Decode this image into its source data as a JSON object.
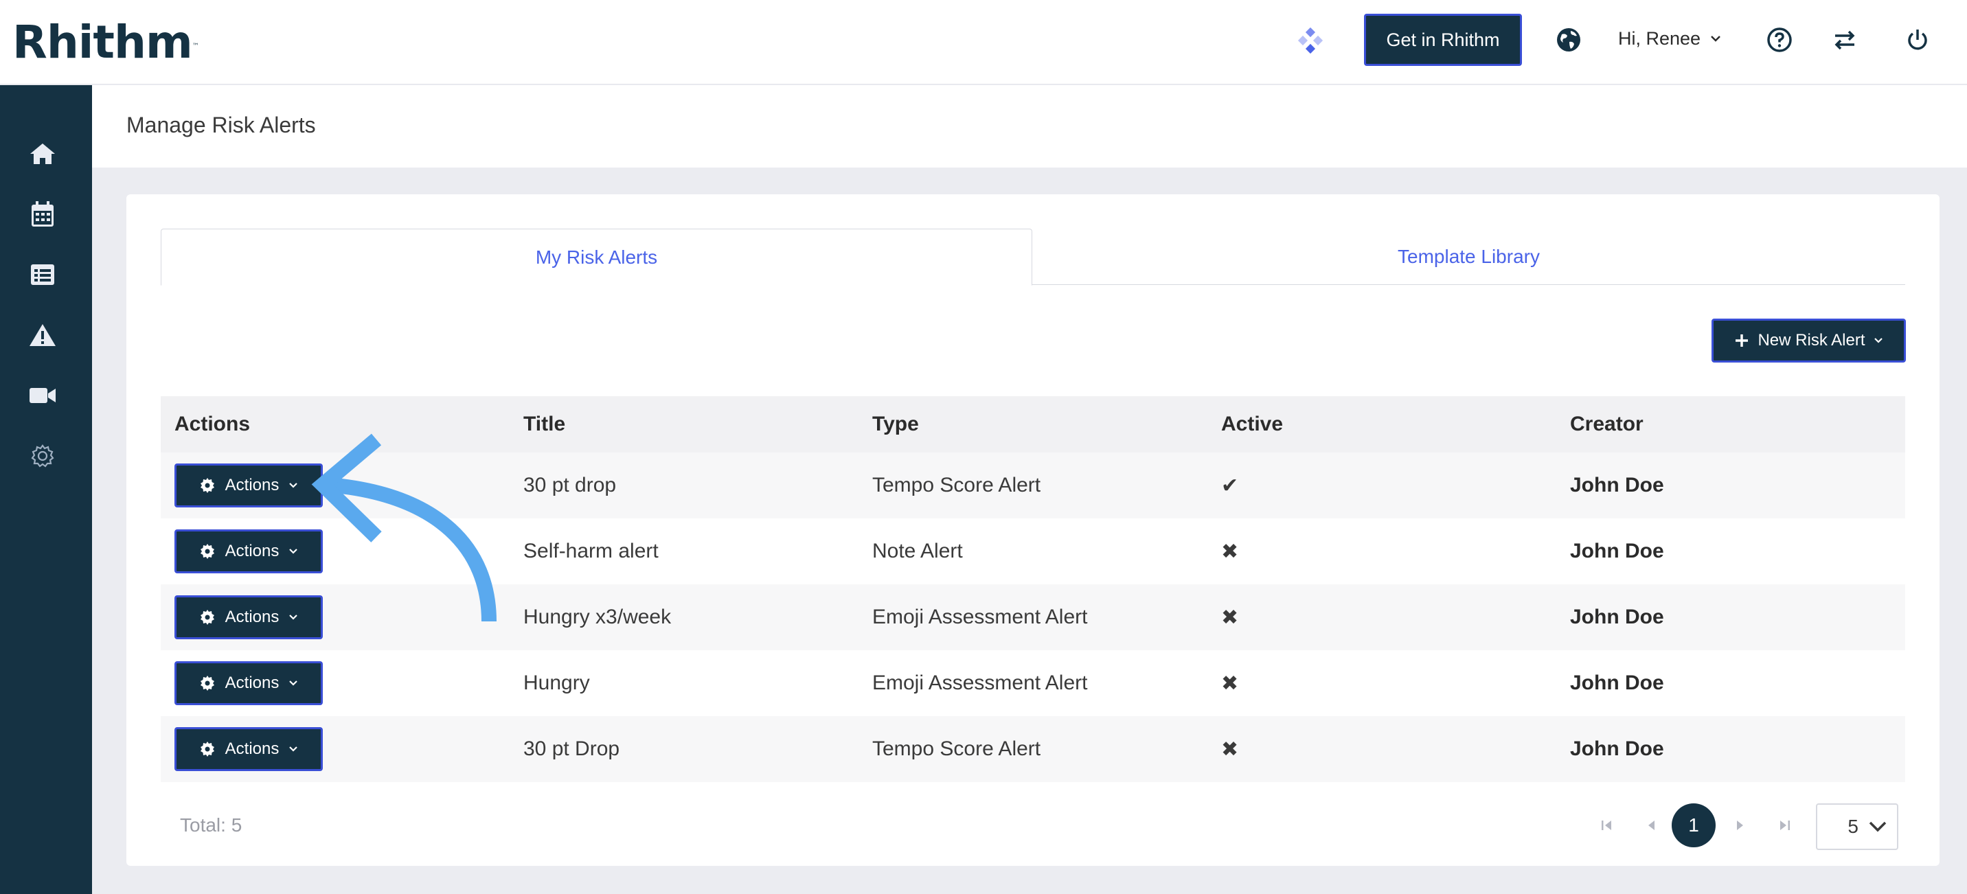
{
  "header": {
    "logo": "Rhithm",
    "logo_tm": "™",
    "get_button": "Get in Rhithm",
    "greeting": "Hi, Renee"
  },
  "page": {
    "title": "Manage Risk Alerts"
  },
  "tabs": [
    {
      "label": "My Risk Alerts",
      "active": true
    },
    {
      "label": "Template Library",
      "active": false
    }
  ],
  "new_button": "New Risk Alert",
  "table": {
    "columns": [
      "Actions",
      "Title",
      "Type",
      "Active",
      "Creator"
    ],
    "action_label": "Actions",
    "rows": [
      {
        "title": "30 pt drop",
        "type": "Tempo Score Alert",
        "active": "✔",
        "creator": "John Doe"
      },
      {
        "title": "Self-harm alert",
        "type": "Note Alert",
        "active": "✖",
        "creator": "John Doe"
      },
      {
        "title": "Hungry x3/week",
        "type": "Emoji Assessment Alert",
        "active": "✖",
        "creator": "John Doe"
      },
      {
        "title": "Hungry",
        "type": "Emoji Assessment Alert",
        "active": "✖",
        "creator": "John Doe"
      },
      {
        "title": "30 pt Drop",
        "type": "Tempo Score Alert",
        "active": "✖",
        "creator": "John Doe"
      }
    ]
  },
  "footer": {
    "total": "Total: 5",
    "current_page": "1",
    "page_size": "5"
  },
  "colors": {
    "navy": "#153243",
    "accent_blue": "#4a63e8",
    "button_border": "#3a4fd6",
    "annotation_arrow": "#5aa9ee"
  }
}
